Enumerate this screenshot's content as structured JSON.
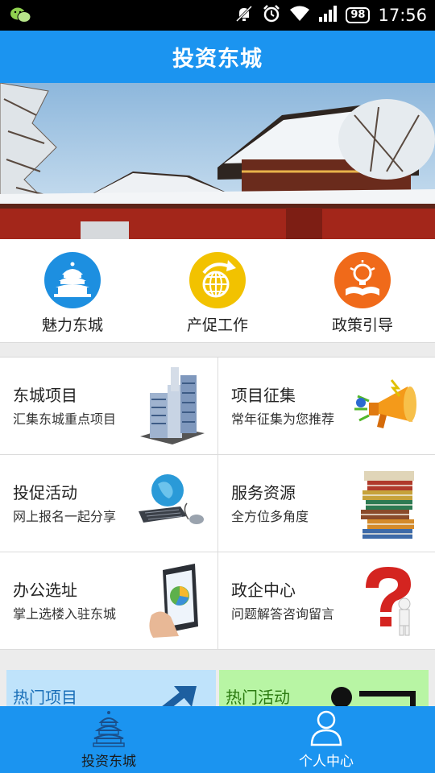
{
  "status_bar": {
    "time": "17:56",
    "battery": "98",
    "icons": [
      "wechat-icon",
      "mute-icon",
      "alarm-icon",
      "wifi-icon",
      "signal-icon",
      "battery-icon"
    ]
  },
  "header": {
    "title": "投资东城"
  },
  "banner": {
    "image": "snow-covered-palace-photo"
  },
  "quick_nav": [
    {
      "label": "魅力东城",
      "icon": "temple-icon",
      "color": "#1d8fe0"
    },
    {
      "label": "产促工作",
      "icon": "globe-arrow-icon",
      "color": "#f2c200"
    },
    {
      "label": "政策引导",
      "icon": "book-bulb-icon",
      "color": "#f06a1a"
    }
  ],
  "grid": [
    {
      "title": "东城项目",
      "subtitle": "汇集东城重点项目",
      "icon": "buildings-icon"
    },
    {
      "title": "项目征集",
      "subtitle": "常年征集为您推荐",
      "icon": "megaphone-icon"
    },
    {
      "title": "投促活动",
      "subtitle": "网上报名一起分享",
      "icon": "computer-globe-icon"
    },
    {
      "title": "服务资源",
      "subtitle": "全方位多角度",
      "icon": "books-stack-icon"
    },
    {
      "title": "办公选址",
      "subtitle": "掌上选楼入驻东城",
      "icon": "phone-hand-icon"
    },
    {
      "title": "政企中心",
      "subtitle": "问题解答咨询留言",
      "icon": "question-mark-icon"
    }
  ],
  "hot": [
    {
      "label": "热门项目",
      "bg": "#bfe3fb",
      "color": "#1a6fb8"
    },
    {
      "label": "热门活动",
      "bg": "#b8f5a4",
      "color": "#2b7a10"
    }
  ],
  "tabs": [
    {
      "label": "投资东城",
      "icon": "temple-tab-icon",
      "active": true
    },
    {
      "label": "个人中心",
      "icon": "person-icon",
      "active": false
    }
  ],
  "colors": {
    "primary": "#1b94f0",
    "tab_active": "#1a1a1a",
    "tab_inactive": "#ffffff"
  }
}
